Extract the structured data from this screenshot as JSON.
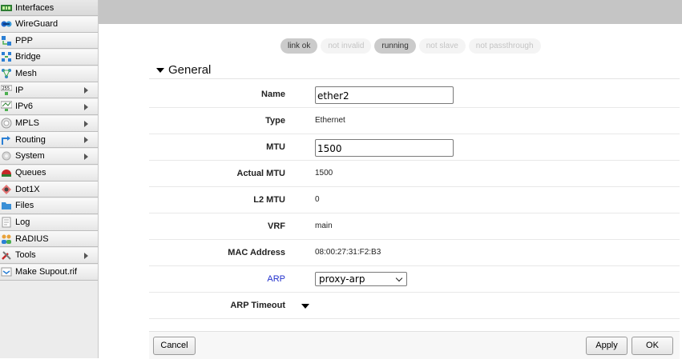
{
  "sidebar": {
    "items": [
      {
        "label": "Interfaces",
        "icon": "interfaces-icon",
        "submenu": false
      },
      {
        "label": "WireGuard",
        "icon": "wireguard-icon",
        "submenu": false
      },
      {
        "label": "PPP",
        "icon": "ppp-icon",
        "submenu": false
      },
      {
        "label": "Bridge",
        "icon": "bridge-icon",
        "submenu": false
      },
      {
        "label": "Mesh",
        "icon": "mesh-icon",
        "submenu": false
      },
      {
        "label": "IP",
        "icon": "ip-icon",
        "submenu": true
      },
      {
        "label": "IPv6",
        "icon": "ipv6-icon",
        "submenu": true
      },
      {
        "label": "MPLS",
        "icon": "mpls-icon",
        "submenu": true
      },
      {
        "label": "Routing",
        "icon": "routing-icon",
        "submenu": true
      },
      {
        "label": "System",
        "icon": "system-icon",
        "submenu": true
      },
      {
        "label": "Queues",
        "icon": "queues-icon",
        "submenu": false
      },
      {
        "label": "Dot1X",
        "icon": "dot1x-icon",
        "submenu": false
      },
      {
        "label": "Files",
        "icon": "files-icon",
        "submenu": false
      },
      {
        "label": "Log",
        "icon": "log-icon",
        "submenu": false
      },
      {
        "label": "RADIUS",
        "icon": "radius-icon",
        "submenu": false
      },
      {
        "label": "Tools",
        "icon": "tools-icon",
        "submenu": true
      },
      {
        "label": "Make Supout.rif",
        "icon": "supout-icon",
        "submenu": false
      }
    ]
  },
  "status_flags": [
    {
      "label": "link ok",
      "active": true
    },
    {
      "label": "not invalid",
      "active": false
    },
    {
      "label": "running",
      "active": true
    },
    {
      "label": "not slave",
      "active": false
    },
    {
      "label": "not passthrough",
      "active": false
    }
  ],
  "section": {
    "title": "General"
  },
  "form": {
    "name": {
      "label": "Name",
      "value": "ether2"
    },
    "type": {
      "label": "Type",
      "value": "Ethernet"
    },
    "mtu": {
      "label": "MTU",
      "value": "1500"
    },
    "actual_mtu": {
      "label": "Actual MTU",
      "value": "1500"
    },
    "l2_mtu": {
      "label": "L2 MTU",
      "value": "0"
    },
    "vrf": {
      "label": "VRF",
      "value": "main"
    },
    "mac_address": {
      "label": "MAC Address",
      "value": "08:00:27:31:F2:B3"
    },
    "arp": {
      "label": "ARP",
      "value": "proxy-arp"
    },
    "arp_timeout": {
      "label": "ARP Timeout"
    }
  },
  "buttons": {
    "cancel": "Cancel",
    "apply": "Apply",
    "ok": "OK"
  },
  "colors": {
    "link_label": "#2230cc",
    "topbar": "#c5c5c5",
    "flag_active": "#cbcbcb",
    "flag_inactive_text": "#c4c4c4"
  }
}
